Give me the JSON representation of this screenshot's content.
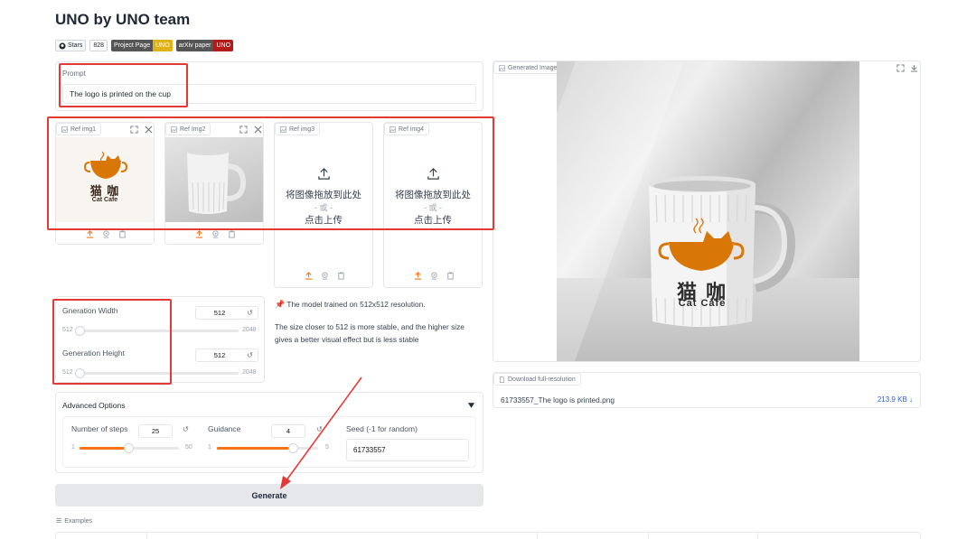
{
  "app": {
    "title": "UNO by UNO team"
  },
  "badges": {
    "stars_label": "Stars",
    "stars_count": "828",
    "project_left": "Project Page",
    "project_right": "UNO",
    "project_right_color": "#dfb317",
    "arxiv_left": "arXiv paper",
    "arxiv_right": "UNO",
    "arxiv_right_color": "#b31b1b"
  },
  "prompt": {
    "label": "Prompt",
    "value": "The logo is printed on the cup"
  },
  "ref_images": [
    {
      "label": "Ref img1",
      "content": "Cat Cafe logo",
      "logo_cn": "猫 咖",
      "logo_en": "Cat Cafe"
    },
    {
      "label": "Ref Img2",
      "content": "white ribbed mug photo"
    },
    {
      "label": "Ref img3",
      "drop_text": "将图像拖放到此处",
      "or_text": "- 或 -",
      "click_text": "点击上传"
    },
    {
      "label": "Ref img4",
      "drop_text": "将图像拖放到此处",
      "or_text": "- 或 -",
      "click_text": "点击上传"
    }
  ],
  "width": {
    "label": "Gneration Width",
    "value": "512",
    "min": "512",
    "max": "2048",
    "fill": 0
  },
  "height": {
    "label": "Generation Height",
    "value": "512",
    "min": "512",
    "max": "2048",
    "fill": 0
  },
  "info": {
    "line1": "The model trained on 512x512 resolution.",
    "line2": "The size closer to 512 is more stable, and the higher size gives a better visual effect but is less stable",
    "pin_icon": "pushpin-icon"
  },
  "advanced": {
    "title": "Advanced Options",
    "steps": {
      "label": "Number of steps",
      "value": "25",
      "min": "1",
      "max": "50",
      "fill": 0.49
    },
    "guidance": {
      "label": "Guidance",
      "value": "4",
      "min": "1",
      "max": "5",
      "fill": 0.75
    },
    "seed": {
      "label": "Seed (-1 for random)",
      "value": "61733557"
    }
  },
  "generate": {
    "label": "Generate"
  },
  "examples": {
    "label": "Examples"
  },
  "output": {
    "label": "Generated Image",
    "logo_cn": "猫 咖",
    "logo_en": "Cat Cafe"
  },
  "download": {
    "label": "Download full-resolution",
    "filename": "61733557_The logo is printed.png",
    "size": "213.9 KB ↓"
  },
  "colors": {
    "accent": "#f97316",
    "highlight": "#e53935",
    "link": "#2563eb"
  }
}
